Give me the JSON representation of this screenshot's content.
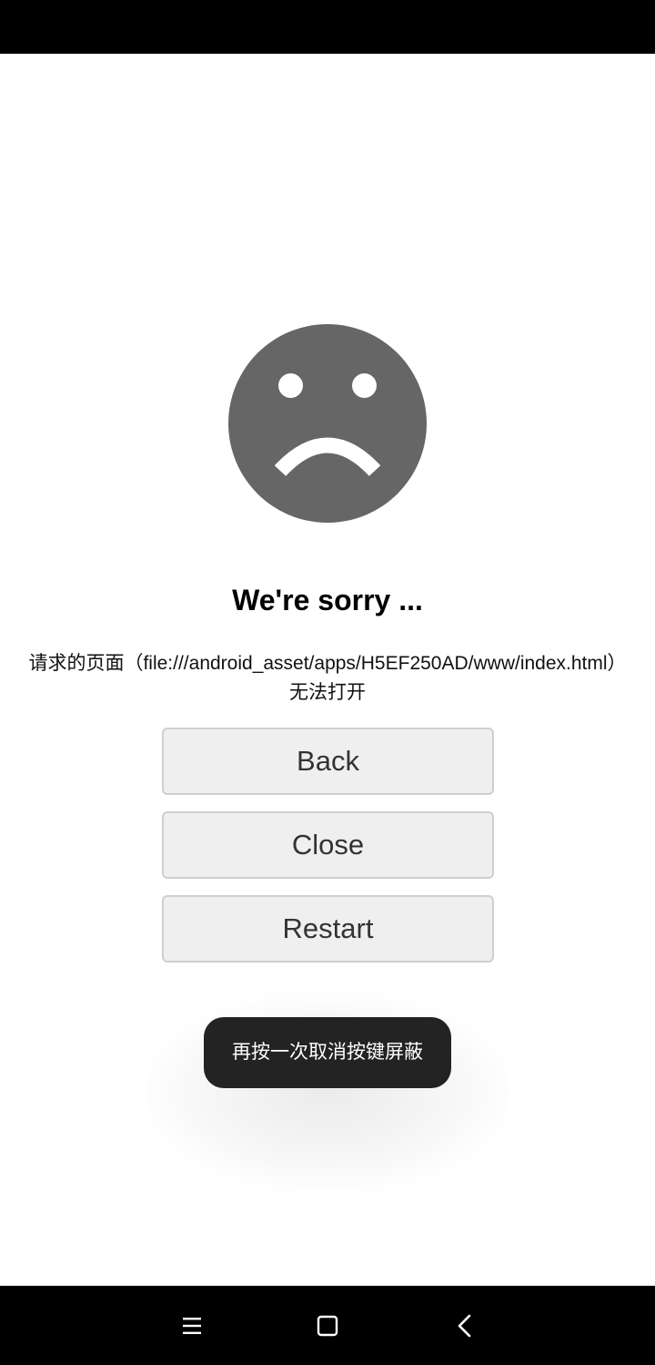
{
  "error_page": {
    "title": "We're sorry ...",
    "message_line1": "请求的页面（file:///android_asset/apps/H5EF250AD/www/index.html）",
    "message_line2": "无法打开",
    "face_icon": "sad-face-icon",
    "face_color": "#666666"
  },
  "buttons": {
    "back_label": "Back",
    "close_label": "Close",
    "restart_label": "Restart"
  },
  "toast": {
    "text": "再按一次取消按键屏蔽"
  },
  "nav_bar": {
    "menu_icon": "menu-icon",
    "home_icon": "home-icon",
    "back_icon": "back-arrow-icon"
  }
}
